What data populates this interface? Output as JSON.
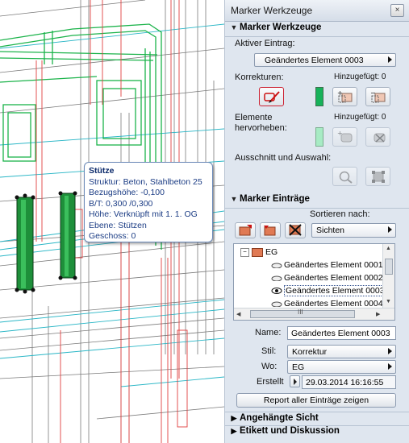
{
  "tooltip": {
    "title": "Stütze",
    "lines": [
      "Struktur: Beton, Stahlbeton 25",
      "Bezugshöhe: -0,100",
      "B/T: 0,300 /0,300",
      "Höhe: Verknüpft mit 1. 1. OG",
      "Ebene: Stützen",
      "Geschoss: 0"
    ]
  },
  "panel": {
    "title": "Marker Werkzeuge",
    "close_glyph": "×",
    "tools_section": "Marker Werkzeuge",
    "active_entry_label": "Aktiver Eintrag:",
    "active_entry_value": "Geändertes Element 0003",
    "corrections_label": "Korrekturen:",
    "corrections_added": "Hinzugefügt: 0",
    "highlight_label_1": "Elemente",
    "highlight_label_2": "hervorheben:",
    "highlight_added": "Hinzugefügt: 0",
    "selection_label": "Ausschnitt und Auswahl:",
    "entries_section": "Marker Einträge",
    "sort_label": "Sortieren nach:",
    "sort_value": "Sichten",
    "tree": {
      "root": "EG",
      "items": [
        "Geändertes Element 0001",
        "Geändertes Element 0002",
        "Geändertes Element 0003",
        "Geändertes Element 0004"
      ],
      "selected_index": 2,
      "hscroll_center_mark": "III"
    },
    "name_label": "Name:",
    "name_value": "Geändertes Element 0003",
    "style_label": "Stil:",
    "style_value": "Korrektur",
    "where_label": "Wo:",
    "where_value": "EG",
    "created_label": "Erstellt",
    "created_value": "29.03.2014 16:16:55",
    "report_button": "Report aller Einträge zeigen",
    "attached_view": "Angehängte Sicht",
    "label_discussion": "Etikett und Diskussion"
  },
  "colors": {
    "panel_bg": "#dfe6ef",
    "marker_green": "#17b25a",
    "highlight_pale_green": "#a7ebc4",
    "model_green": "#1bb34a",
    "model_red": "#e04040",
    "model_cyan": "#29b6c6"
  }
}
